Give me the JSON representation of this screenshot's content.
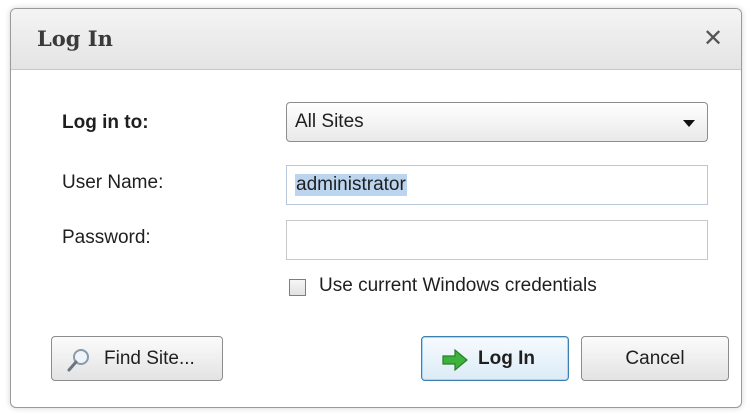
{
  "window": {
    "title": "Log In",
    "close_glyph": "✕"
  },
  "form": {
    "login_to_label": "Log in to:",
    "site_select": {
      "selected": "All Sites"
    },
    "username_label": "User Name:",
    "username_value": "administrator",
    "password_label": "Password:",
    "password_value": "",
    "windows_credentials_label": "Use current Windows credentials",
    "windows_credentials_checked": false
  },
  "buttons": {
    "find_site": {
      "label": "Find Site...",
      "icon": "magnifier-icon"
    },
    "log_in": {
      "label": "Log In",
      "icon": "green-arrow-icon"
    },
    "cancel": {
      "label": "Cancel"
    }
  },
  "colors": {
    "selection_highlight": "#bcd5ef",
    "login_arrow_green": "#3cb43c",
    "default_button_border": "#3c7fb1"
  }
}
